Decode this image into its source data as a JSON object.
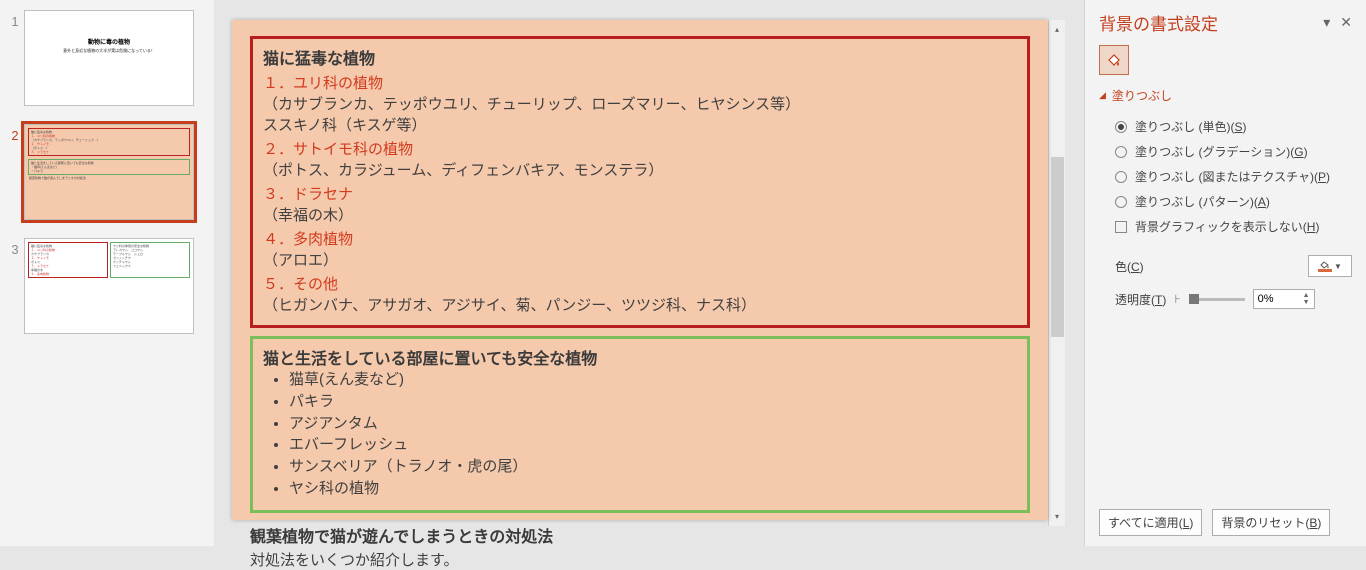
{
  "thumbnails": {
    "items": [
      {
        "num": "1",
        "title": "動物に毒の植物",
        "sub": "意外と身近な植物の大半が実は危険になっている！"
      },
      {
        "num": "2"
      },
      {
        "num": "3"
      }
    ],
    "selected_index": 1
  },
  "slide": {
    "box_red": {
      "heading": "猫に猛毒な植物",
      "items": [
        {
          "num": "１．ユリ科の植物",
          "body": "（カサブランカ、テッポウユリ、チューリップ、ローズマリー、ヒヤシンス等）\nススキノ科（キスゲ等）"
        },
        {
          "num": "２．サトイモ科の植物",
          "body": "（ポトス、カラジューム、ディフェンバキア、モンステラ）"
        },
        {
          "num": "３．ドラセナ",
          "body": "（幸福の木）"
        },
        {
          "num": "４．多肉植物",
          "body": "（アロエ）"
        },
        {
          "num": "５．その他",
          "body": "（ヒガンバナ、アサガオ、アジサイ、菊、パンジー、ツツジ科、ナス科）"
        }
      ]
    },
    "box_green": {
      "heading": "猫と生活をしている部屋に置いても安全な植物",
      "bullets": [
        "猫草(えん麦など)",
        "パキラ",
        "アジアンタム",
        "エバーフレッシュ",
        "サンスベリア（トラノオ・虎の尾）",
        "ヤシ科の植物"
      ]
    },
    "section3": {
      "heading": "観葉植物で猫が遊んでしまうときの対処法",
      "sub": "対処法をいくつか紹介します。"
    }
  },
  "panel": {
    "title": "背景の書式設定",
    "section_fill": "塗りつぶし",
    "fill_options": {
      "solid": "塗りつぶし (単色)(S)",
      "gradient": "塗りつぶし (グラデーション)(G)",
      "picture": "塗りつぶし (図またはテクスチャ)(P)",
      "pattern": "塗りつぶし (パターン)(A)"
    },
    "hide_bg": "背景グラフィックを表示しない(H)",
    "color_label": "色(C)",
    "transparency_label": "透明度(T)",
    "transparency_value": "0%",
    "btn_apply_all": "すべてに適用(L)",
    "btn_reset": "背景のリセット(B)"
  }
}
